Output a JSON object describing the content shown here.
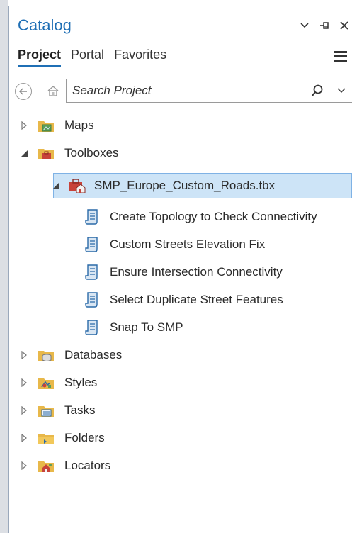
{
  "panel": {
    "title": "Catalog",
    "tabs": [
      "Project",
      "Portal",
      "Favorites"
    ],
    "active_tab": "Project"
  },
  "search": {
    "placeholder": "Search Project"
  },
  "tree": {
    "maps": "Maps",
    "toolboxes": "Toolboxes",
    "toolbox_file": "SMP_Europe_Custom_Roads.tbx",
    "scripts": [
      "Create Topology to Check Connectivity",
      "Custom Streets Elevation Fix",
      "Ensure Intersection Connectivity",
      "Select Duplicate Street Features",
      "Snap To SMP"
    ],
    "databases": "Databases",
    "styles": "Styles",
    "tasks": "Tasks",
    "folders": "Folders",
    "locators": "Locators"
  },
  "colors": {
    "accent": "#1f6fb5",
    "selection": "#cde4f7",
    "folder": "#e8b84a"
  }
}
